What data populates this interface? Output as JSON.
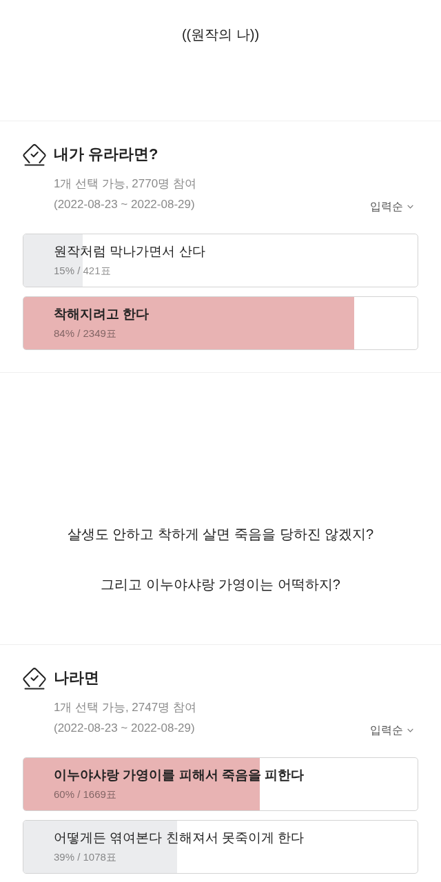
{
  "content": [
    {
      "kind": "paragraph",
      "lines": [
        "((원작의 나))"
      ]
    },
    {
      "kind": "poll",
      "title": "내가 유라라면?",
      "meta": "1개 선택 가능, 2770명 참여",
      "period": "(2022-08-23 ~ 2022-08-29)",
      "sort_label": "입력순",
      "options": [
        {
          "label": "원작처럼 막나가면서 산다",
          "result": "15% / 421표",
          "level": 0.15,
          "leading": false
        },
        {
          "label": "착해지려고 한다",
          "result": "84% / 2349표",
          "level": 0.84,
          "leading": true
        }
      ]
    },
    {
      "kind": "paragraph",
      "lines": [
        "살생도 안하고 착하게 살면 죽음을 당하진 않겠지?",
        "그리고 이누야샤랑 가영이는 어떡하지?"
      ]
    },
    {
      "kind": "poll",
      "title": "나라면",
      "meta": "1개 선택 가능, 2747명 참여",
      "period": "(2022-08-23 ~ 2022-08-29)",
      "sort_label": "입력순",
      "options": [
        {
          "label": "이누야샤랑 가영이를 피해서 죽음을 피한다",
          "result": "60% / 1669표",
          "level": 0.6,
          "leading": true
        },
        {
          "label": "어떻게든 엮여본다 친해져서 못죽이게 한다",
          "result": "39% / 1078표",
          "level": 0.39,
          "leading": false
        }
      ]
    }
  ]
}
